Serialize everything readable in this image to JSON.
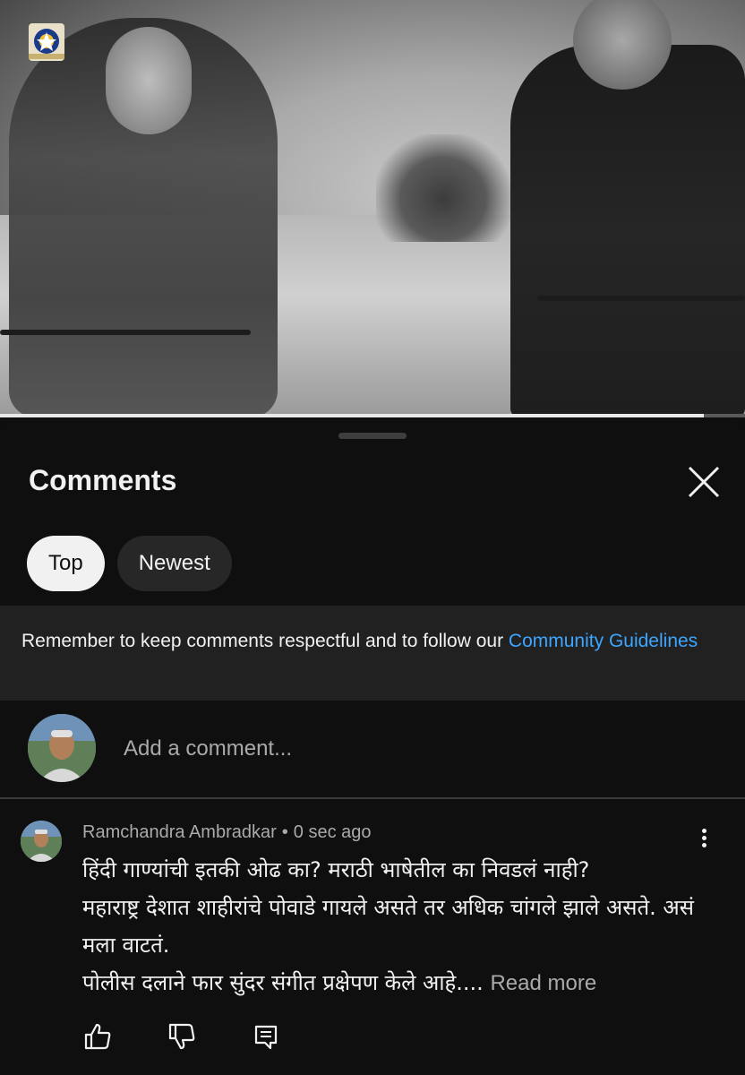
{
  "video": {
    "progress_fraction": 0.945
  },
  "comments_panel": {
    "title": "Comments",
    "close_icon": "close-icon",
    "sort_chips": [
      {
        "label": "Top",
        "active": true
      },
      {
        "label": "Newest",
        "active": false
      }
    ],
    "notice": {
      "text": "Remember to keep comments respectful and to follow our ",
      "link": "Community Guidelines"
    },
    "add_comment": {
      "placeholder": "Add a comment..."
    },
    "comment": {
      "author": "Ramchandra Ambradkar",
      "separator": "•",
      "time": "0 sec ago",
      "lines": [
        "हिंदी गाण्यांची इतकी ओढ का? मराठी भाषेतील का निवडलं नाही?",
        "महाराष्ट्र देशात शाहीरांचे पोवाडे गायले असते तर अधिक चांगले झाले असते. असं मला वाटतं.",
        "पोलीस दलाने फार सुंदर संगीत प्रक्षेपण केले आहे...."
      ],
      "read_more": "Read more",
      "actions": [
        "like-icon",
        "dislike-icon",
        "reply-icon"
      ],
      "menu_icon": "more-vert-icon"
    }
  },
  "colors": {
    "background": "#0f0f0f",
    "notice_bg": "#212121",
    "link": "#3ea6ff",
    "secondary_text": "#aaaaaa"
  }
}
